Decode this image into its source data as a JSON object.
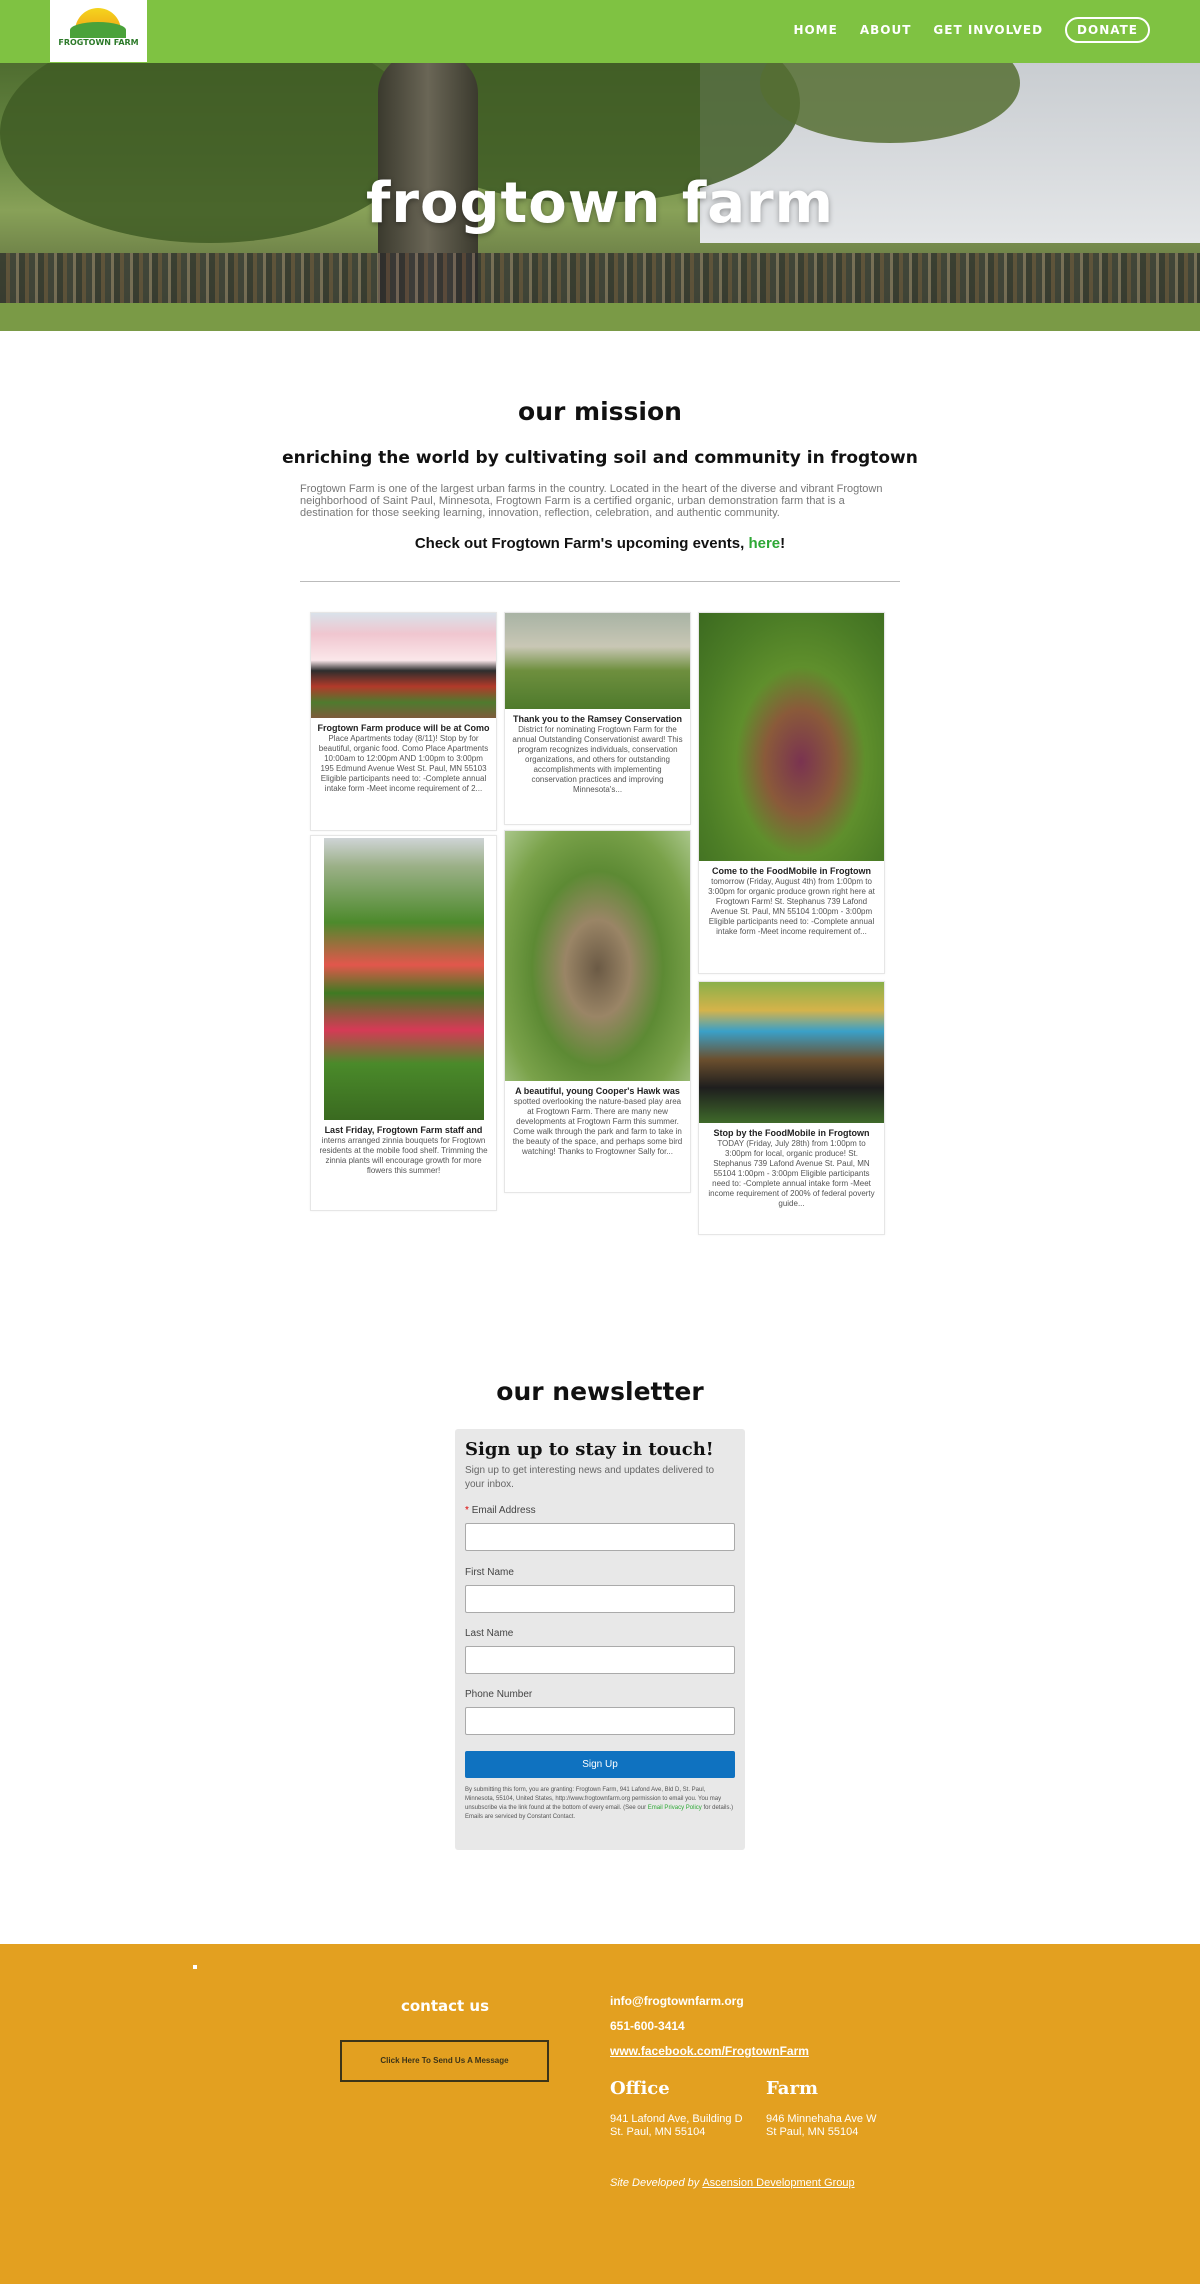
{
  "header": {
    "logo_text": "FROGTOWN FARM",
    "nav": [
      {
        "label": "HOME"
      },
      {
        "label": "ABOUT"
      },
      {
        "label": "GET INVOLVED"
      },
      {
        "label": "DONATE"
      }
    ]
  },
  "hero": {
    "title": "frogtown farm"
  },
  "mission": {
    "heading": "our mission",
    "subheading": "enriching the world by cultivating soil and community in frogtown",
    "body": "Frogtown Farm is one of the largest urban farms in the country. Located in the heart of the diverse and vibrant Frogtown neighborhood of Saint Paul, Minnesota, Frogtown Farm is a certified organic, urban demonstration farm that is a destination for those seeking learning, innovation, reflection, celebration, and authentic community.",
    "events_text": "Check out Frogtown Farm's upcoming events, ",
    "events_link": "here",
    "events_end": "!"
  },
  "feed": [
    {
      "title": "Frogtown Farm produce will be at Como",
      "text": "Place Apartments today (8/11)! Stop by for beautiful, organic food. Como Place Apartments 10:00am to 12:00pm AND 1:00pm to 3:00pm 195 Edmund Avenue West St. Paul, MN 55103 Eligible participants need to: -Complete annual intake form -Meet income requirement of 2..."
    },
    {
      "title": "Thank you to the Ramsey Conservation",
      "text": "District for nominating Frogtown Farm for the annual Outstanding Conservationist award! This program recognizes individuals, conservation organizations, and others for outstanding accomplishments with implementing conservation practices and improving Minnesota's..."
    },
    {
      "title": "Come to the FoodMobile in Frogtown",
      "text": "tomorrow (Friday, August 4th) from 1:00pm to 3:00pm for organic produce grown right here at Frogtown Farm! St. Stephanus 739 Lafond Avenue St. Paul, MN 55104 1:00pm - 3:00pm Eligible participants need to: -Complete annual intake form -Meet income requirement of..."
    },
    {
      "title": "Last Friday, Frogtown Farm staff and",
      "text": "interns arranged zinnia bouquets for Frogtown residents at the mobile food shelf. Trimming the zinnia plants will encourage growth for more flowers this summer!"
    },
    {
      "title": "A beautiful, young Cooper's Hawk was",
      "text": "spotted overlooking the nature-based play area at Frogtown Farm. There are many new developments at Frogtown Farm this summer. Come walk through the park and farm to take in the beauty of the space, and perhaps some bird watching! Thanks to Frogtowner Sally for..."
    },
    {
      "title": "Stop by the FoodMobile in Frogtown",
      "text": "TODAY (Friday, July 28th) from 1:00pm to 3:00pm for local, organic produce! St. Stephanus 739 Lafond Avenue St. Paul, MN 55104 1:00pm - 3:00pm Eligible participants need to: -Complete annual intake form -Meet income requirement of 200% of federal poverty guide..."
    }
  ],
  "newsletter": {
    "heading": "our newsletter",
    "title": "Sign up to stay in touch!",
    "subtitle": "Sign up to get interesting news and updates delivered to your inbox.",
    "required_mark": "*",
    "fields": [
      {
        "label": "Email Address",
        "value": ""
      },
      {
        "label": "First Name",
        "value": ""
      },
      {
        "label": "Last Name",
        "value": ""
      },
      {
        "label": "Phone Number",
        "value": ""
      }
    ],
    "button": "Sign Up",
    "legal": "By submitting this form, you are granting: Frogtown Farm, 941 Lafond Ave, Bld D, St. Paul, Minnesota, 55104, United States, http://www.frogtownfarm.org permission to email you. You may unsubscribe via the link found at the bottom of every email. (See our ",
    "legal_link": "Email Privacy Policy",
    "legal_end": " for details.) Emails are serviced by Constant Contact."
  },
  "footer": {
    "contact_heading": "contact us",
    "cta": "Click Here To Send Us A Message",
    "email": "info@frogtownfarm.org",
    "phone": "651-600-3414",
    "facebook": "www.facebook.com/FrogtownFarm",
    "office_heading": "Office",
    "office_line1": "941 Lafond Ave, Building D",
    "office_line2": "St. Paul, MN 55104",
    "farm_heading": "Farm",
    "farm_line1": "946 Minnehaha Ave W",
    "farm_line2": "St Paul, MN 55104",
    "dev_text": "Site Developed by ",
    "dev_link": "Ascension Development Group"
  },
  "colors": {
    "header_green": "#7fc242",
    "footer_gold": "#e3a020",
    "link_green": "#2ea836",
    "signup_blue": "#0f72c0"
  }
}
